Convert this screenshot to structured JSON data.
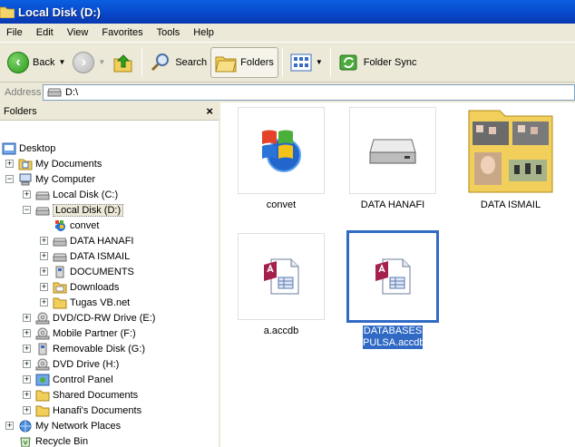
{
  "window": {
    "title": "Local Disk (D:)"
  },
  "menu": [
    "File",
    "Edit",
    "View",
    "Favorites",
    "Tools",
    "Help"
  ],
  "toolbar": {
    "back": "Back",
    "search": "Search",
    "folders": "Folders",
    "folder_sync": "Folder Sync"
  },
  "address": {
    "label": "Address",
    "value": "D:\\"
  },
  "folders_pane": {
    "title": "Folders",
    "close": "×",
    "items": [
      "Desktop",
      "My Documents",
      "My Computer",
      "Local Disk (C:)",
      "Local Disk (D:)",
      "convet",
      "DATA HANAFI",
      "DATA ISMAIL",
      "DOCUMENTS",
      "Downloads",
      "Tugas VB.net",
      "DVD/CD-RW Drive (E:)",
      "Mobile Partner (F:)",
      "Removable Disk (G:)",
      "DVD Drive (H:)",
      "Control Panel",
      "Shared Documents",
      "Hanafi's Documents",
      "My Network Places",
      "Recycle Bin"
    ]
  },
  "files": [
    {
      "name": "convet",
      "icon": "windows-logo-icon"
    },
    {
      "name": "DATA HANAFI",
      "icon": "drive-icon"
    },
    {
      "name": "DATA ISMAIL",
      "icon": "photo-folder-icon"
    },
    {
      "name": "a.accdb",
      "icon": "access-file-icon"
    },
    {
      "name": "DATABASES PULSA.accdb",
      "icon": "access-file-icon",
      "selected": true
    }
  ],
  "colors": {
    "title_bar": "#0846c9",
    "selection": "#316ac5",
    "chrome": "#ece9d8"
  }
}
